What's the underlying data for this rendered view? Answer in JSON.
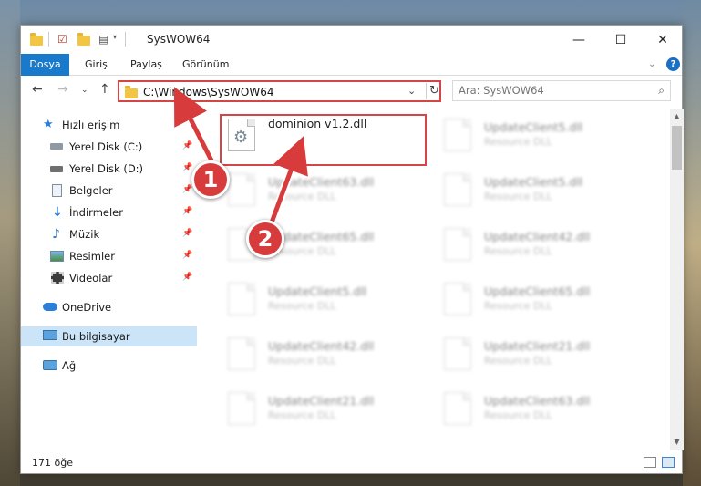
{
  "window": {
    "title": "SysWOW64",
    "controls": {
      "minimize": "—",
      "maximize": "☐",
      "close": "✕"
    }
  },
  "ribbon": {
    "tabs": [
      "Dosya",
      "Giriş",
      "Paylaş",
      "Görünüm"
    ],
    "help": "?",
    "accent": "#1979ca"
  },
  "nav": {
    "address": "C:\\Windows\\SysWOW64",
    "search_placeholder": "Ara: SysWOW64"
  },
  "sidebar": {
    "quick_access": "Hızlı erişim",
    "items": [
      "Yerel Disk (C:)",
      "Yerel Disk (D:)",
      "Belgeler",
      "İndirmeler",
      "Müzik",
      "Resimler",
      "Videolar"
    ],
    "onedrive": "OneDrive",
    "this_pc": "Bu bilgisayar",
    "network": "Ağ"
  },
  "files": {
    "selected": {
      "name": "dominion v1.2.dll"
    },
    "left_column": [
      {
        "name": "UpdateClient63.dll",
        "desc": "Resource DLL"
      },
      {
        "name": "UpdateClient65.dll",
        "desc": "Resource DLL"
      },
      {
        "name": "UpdateClient5.dll",
        "desc": "Resource DLL"
      },
      {
        "name": "UpdateClient42.dll",
        "desc": "Resource DLL"
      },
      {
        "name": "UpdateClient21.dll",
        "desc": "Resource DLL"
      }
    ],
    "right_column": [
      {
        "name": "UpdateClient5.dll",
        "desc": "Resource DLL"
      },
      {
        "name": "UpdateClient5.dll",
        "desc": "Resource DLL"
      },
      {
        "name": "UpdateClient42.dll",
        "desc": "Resource DLL"
      },
      {
        "name": "UpdateClient65.dll",
        "desc": "Resource DLL"
      },
      {
        "name": "UpdateClient21.dll",
        "desc": "Resource DLL"
      },
      {
        "name": "UpdateClient63.dll",
        "desc": "Resource DLL"
      }
    ]
  },
  "status": {
    "count": "171 öğe"
  },
  "callouts": {
    "one": "1",
    "two": "2",
    "color": "#d73b3b"
  }
}
